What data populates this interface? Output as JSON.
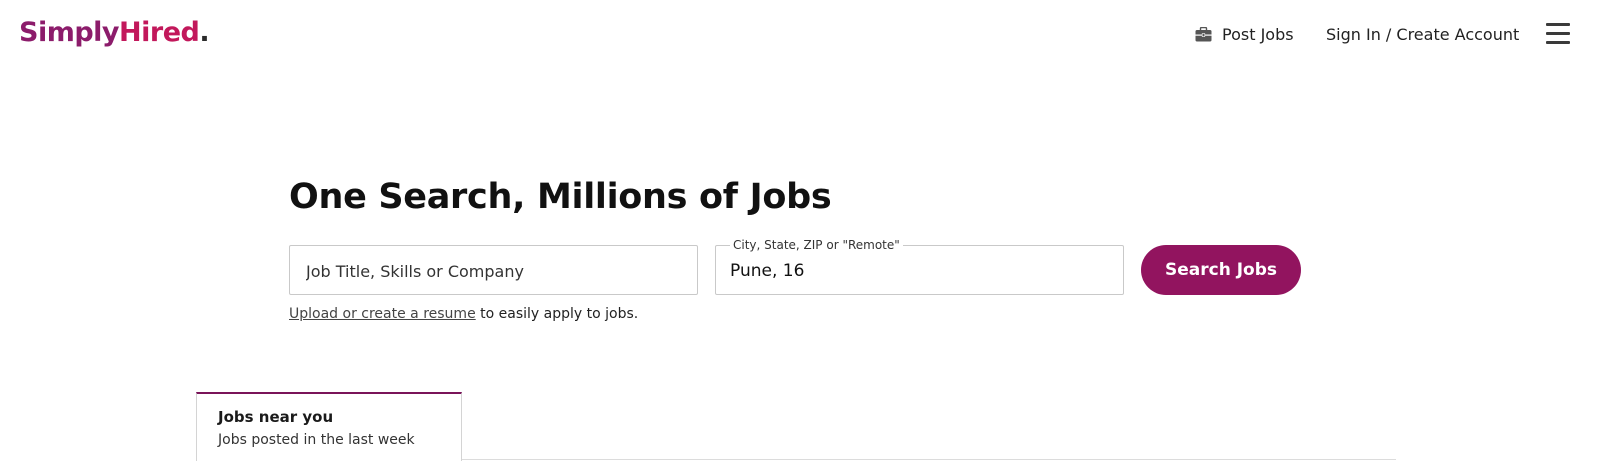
{
  "header": {
    "logo": {
      "part1": "Simply",
      "part2": "Hired",
      "part3": "."
    },
    "post_jobs_label": "Post Jobs",
    "post_jobs_icon": "briefcase-icon",
    "sign_in_label": "Sign In / Create Account",
    "menu_icon": "hamburger-menu-icon"
  },
  "hero": {
    "title": "One Search, Millions of Jobs",
    "what": {
      "placeholder": "Job Title, Skills or Company",
      "value": ""
    },
    "where": {
      "label": "City, State, ZIP or \"Remote\"",
      "value": "Pune, 16"
    },
    "search_button_label": "Search Jobs",
    "resume_link_label": "Upload or create a resume",
    "resume_suffix": " to easily apply to jobs."
  },
  "tabs": [
    {
      "title": "Jobs near you",
      "subtitle": "Jobs posted in the last week"
    }
  ],
  "colors": {
    "brand_primary": "#92145f",
    "logo_simply": "#8c1c6b",
    "logo_hired": "#c2185b",
    "tab_accent": "#7a1459"
  }
}
